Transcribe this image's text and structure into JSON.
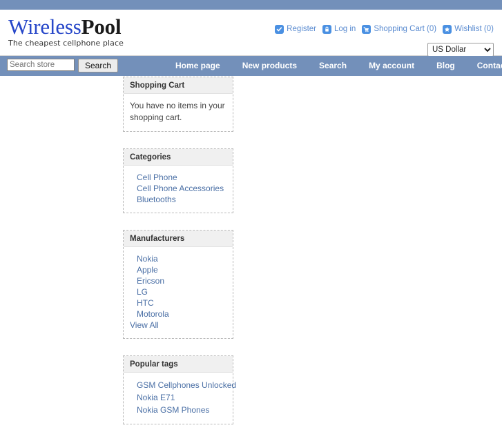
{
  "brand": {
    "name_part1": "Wireless",
    "name_part2": "Pool",
    "tagline": "The cheapest cellphone place"
  },
  "header": {
    "links": [
      {
        "label": "Register",
        "icon": "check-icon"
      },
      {
        "label": "Log in",
        "icon": "lock-icon"
      },
      {
        "label": "Shopping Cart (0)",
        "icon": "cart-icon"
      },
      {
        "label": "Wishlist (0)",
        "icon": "star-icon"
      }
    ],
    "currency": {
      "selected": "US Dollar",
      "options": [
        "US Dollar"
      ]
    }
  },
  "search": {
    "placeholder": "Search store",
    "value": "",
    "button_label": "Search"
  },
  "nav": {
    "items": [
      {
        "label": "Home page"
      },
      {
        "label": "New products"
      },
      {
        "label": "Search"
      },
      {
        "label": "My account"
      },
      {
        "label": "Blog"
      },
      {
        "label": "Contact Us"
      }
    ]
  },
  "sidebar": {
    "shopping_cart": {
      "title": "Shopping Cart",
      "empty_message": "You have no items in your shopping cart."
    },
    "categories": {
      "title": "Categories",
      "items": [
        {
          "label": "Cell Phone"
        },
        {
          "label": "Cell Phone Accessories"
        },
        {
          "label": "Bluetooths"
        }
      ]
    },
    "manufacturers": {
      "title": "Manufacturers",
      "items": [
        {
          "label": "Nokia"
        },
        {
          "label": "Apple"
        },
        {
          "label": "Ericson"
        },
        {
          "label": "LG"
        },
        {
          "label": "HTC"
        },
        {
          "label": "Motorola"
        }
      ],
      "view_all_label": "View All"
    },
    "popular_tags": {
      "title": "Popular tags",
      "tags": [
        {
          "label": "GSM Cellphones Unlocked"
        },
        {
          "label": "Nokia E71"
        },
        {
          "label": "Nokia GSM Phones"
        }
      ]
    }
  },
  "colors": {
    "brand_blue": "#7390ba",
    "logo_blue": "#2747c9",
    "link_blue": "#4a6fa5",
    "header_link_blue": "#5a8bd0",
    "icon_blue": "#4a90e2",
    "block_title_bg": "#f0f0f0"
  }
}
